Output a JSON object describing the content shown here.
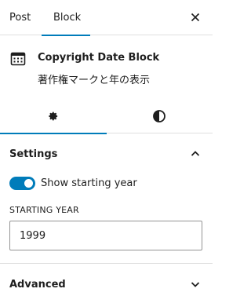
{
  "tabs": {
    "post": "Post",
    "block": "Block",
    "active": "block"
  },
  "block": {
    "title": "Copyright Date Block",
    "description": "著作権マークと年の表示",
    "icon": "calendar-icon"
  },
  "style_tabs": [
    {
      "name": "settings",
      "icon": "gear-icon",
      "active": true
    },
    {
      "name": "styles",
      "icon": "contrast-icon",
      "active": false
    }
  ],
  "settings_panel": {
    "title": "Settings",
    "expanded": true,
    "toggle_label": "Show starting year",
    "toggle_on": true,
    "field_label": "STARTING YEAR",
    "field_value": "1999"
  },
  "advanced_panel": {
    "title": "Advanced",
    "expanded": false
  },
  "colors": {
    "accent": "#007cba",
    "text": "#1e1e1e",
    "border": "#e0e0e0"
  }
}
